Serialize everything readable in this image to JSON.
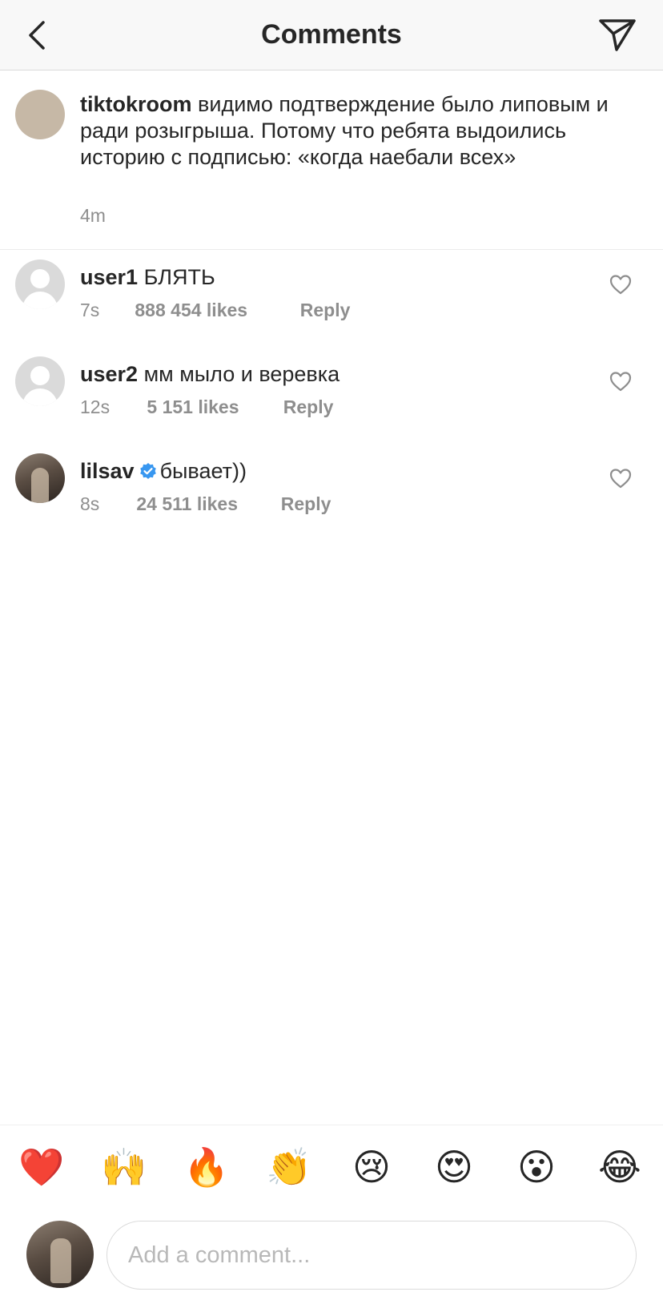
{
  "header": {
    "title": "Comments",
    "back_icon": "chevron-left-icon",
    "share_icon": "paper-plane-icon"
  },
  "caption": {
    "username": "tiktokroom",
    "text": "видимо подтверждение было липовым и ради розыгрыша. Потому что ребята выдоились историю с подписью: «когда наебали всех»",
    "time": "4m"
  },
  "comments": [
    {
      "username": "user1",
      "text": "БЛЯТЬ",
      "time": "7s",
      "likes": "888 454 likes",
      "reply": "Reply",
      "verified": false
    },
    {
      "username": "user2",
      "text": "мм мыло и веревка",
      "time": "12s",
      "likes": "5 151 likes",
      "reply": "Reply",
      "verified": false
    },
    {
      "username": "lilsav",
      "text": "бывает))",
      "time": "8s",
      "likes": "24 511 likes",
      "reply": "Reply",
      "verified": true
    }
  ],
  "emoji_bar": [
    "❤️",
    "🙌",
    "🔥",
    "👏",
    "😢",
    "😍",
    "😮",
    "😂"
  ],
  "composer": {
    "placeholder": "Add a comment..."
  },
  "colors": {
    "text": "#262626",
    "secondary": "#8e8e8e",
    "verified": "#3897f0",
    "header_bg": "#f8f8f8"
  }
}
